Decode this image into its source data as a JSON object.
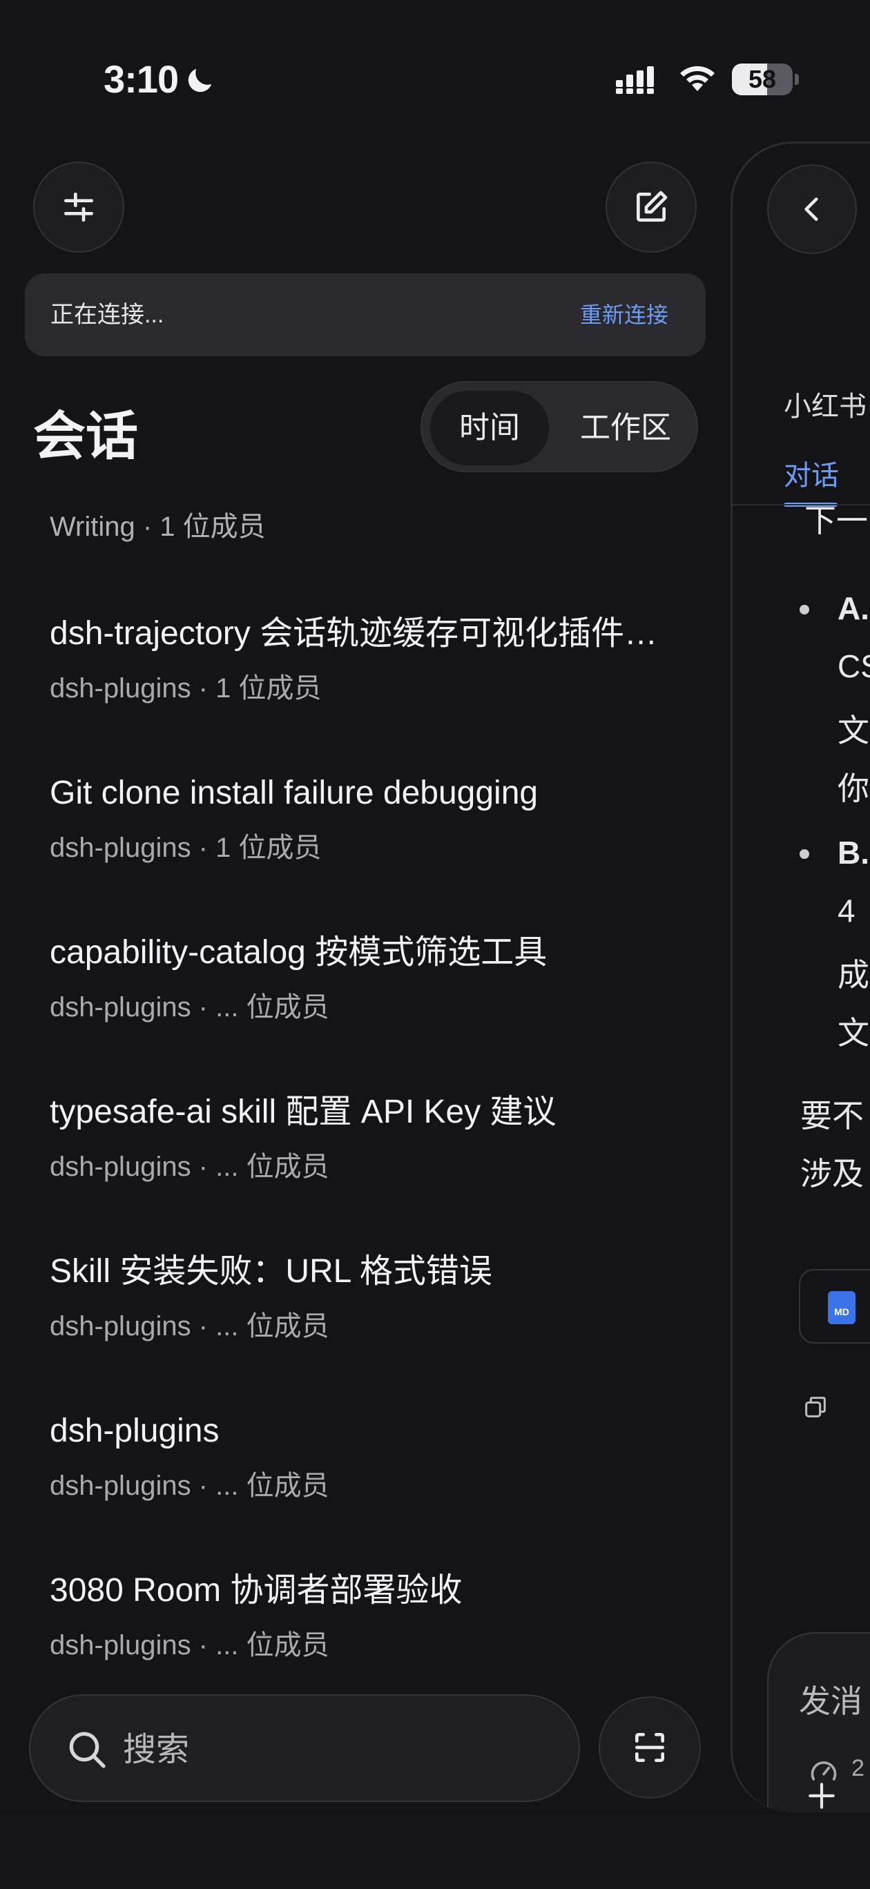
{
  "status_bar": {
    "time": "3:10",
    "battery": "58",
    "battery_level": 0.58,
    "icons": [
      "moon-icon",
      "signal-icon",
      "wifi-icon",
      "battery-icon"
    ]
  },
  "toolbar": {
    "filter_icon": "sliders-icon",
    "compose_icon": "compose-icon"
  },
  "connection": {
    "status": "正在连接...",
    "reconnect": "重新连接"
  },
  "sessions_header": {
    "title": "会话",
    "segments": [
      "时间",
      "工作区"
    ],
    "active_segment": "时间"
  },
  "sessions": {
    "group_label": "Writing · 1 位成员",
    "items": [
      {
        "title": "dsh-trajectory 会话轨迹缓存可视化插件实现",
        "subtitle": "dsh-plugins · 1 位成员"
      },
      {
        "title": "Git clone install failure debugging",
        "subtitle": "dsh-plugins · 1 位成员"
      },
      {
        "title": "capability-catalog 按模式筛选工具",
        "subtitle": "dsh-plugins · ... 位成员"
      },
      {
        "title": "typesafe-ai skill 配置 API Key 建议",
        "subtitle": "dsh-plugins · ... 位成员"
      },
      {
        "title": "Skill 安装失败：URL 格式错误",
        "subtitle": "dsh-plugins · ... 位成员"
      },
      {
        "title": "dsh-plugins",
        "subtitle": "dsh-plugins · ... 位成员"
      },
      {
        "title": "3080 Room 协调者部署验收",
        "subtitle": "dsh-plugins · ... 位成员"
      }
    ]
  },
  "search": {
    "placeholder": "搜索",
    "value": "",
    "scan_icon": "scan-icon"
  },
  "detail_panel": {
    "title": "小红书",
    "active_tab": "对话",
    "line_top": "下一",
    "bullet_a": {
      "label": "A.",
      "lines": [
        "CS",
        "文",
        "你"
      ]
    },
    "bullet_b": {
      "label": "B.",
      "lines": [
        "4",
        "成",
        "文"
      ]
    },
    "para_lines": [
      "要不",
      "涉及"
    ],
    "file_badge": "MD",
    "input_placeholder": "发消",
    "gauge_value": "2"
  },
  "colors": {
    "background": "#141416",
    "accent": "#6e9cf5",
    "surface": "#2a2a2e"
  }
}
